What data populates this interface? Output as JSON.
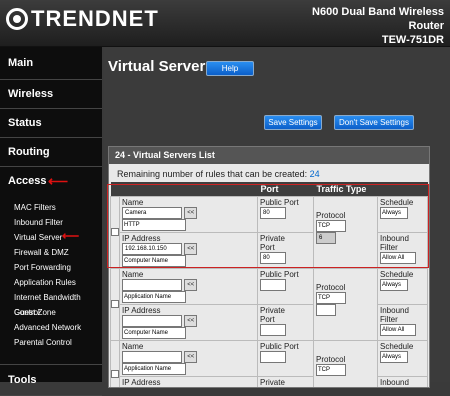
{
  "header": {
    "brand": "TRENDNET",
    "model_line1": "N600 Dual Band Wireless",
    "model_line2": "Router",
    "model_line3": "TEW-751DR"
  },
  "sidebar": {
    "main": "Main",
    "wireless": "Wireless",
    "status": "Status",
    "routing": "Routing",
    "access": "Access",
    "sub": [
      "MAC Filters",
      "Inbound Filter",
      "Virtual Server",
      "Firewall & DMZ",
      "Port Forwarding",
      "Application Rules",
      "Internet Bandwidth Control",
      "Guest Zone",
      "Advanced Network",
      "Parental Control"
    ],
    "tools": "Tools"
  },
  "page": {
    "title": "Virtual Server",
    "help": "Help",
    "save": "Save Settings",
    "dont_save": "Don't Save Settings"
  },
  "list": {
    "heading": "24 - Virtual Servers List",
    "remaining_label": "Remaining number of rules that can be created:",
    "remaining_count": "24",
    "col_port": "Port",
    "col_traffic": "Traffic Type",
    "name_label": "Name",
    "ip_label": "IP Address",
    "public_port": "Public Port",
    "private_port": "Private Port",
    "protocol": "Protocol",
    "schedule": "Schedule",
    "inbound": "Inbound Filter",
    "add_btn": "<<",
    "rows": [
      {
        "name": "Camera",
        "app": "HTTP",
        "ip": "192.168.10.150",
        "computer": "Computer Name",
        "pub": "80",
        "priv": "80",
        "proto": "TCP",
        "proto_num": "6",
        "schedule": "Always",
        "filter": "Allow All"
      },
      {
        "name": "",
        "app": "Application Name",
        "ip": "",
        "computer": "Computer Name",
        "pub": "",
        "priv": "",
        "proto": "TCP",
        "proto_num": "",
        "schedule": "Always",
        "filter": "Allow All"
      },
      {
        "name": "",
        "app": "Application Name",
        "ip": "",
        "computer": "",
        "pub": "",
        "priv": "",
        "proto": "TCP",
        "proto_num": "",
        "schedule": "Always",
        "filter": ""
      }
    ]
  }
}
